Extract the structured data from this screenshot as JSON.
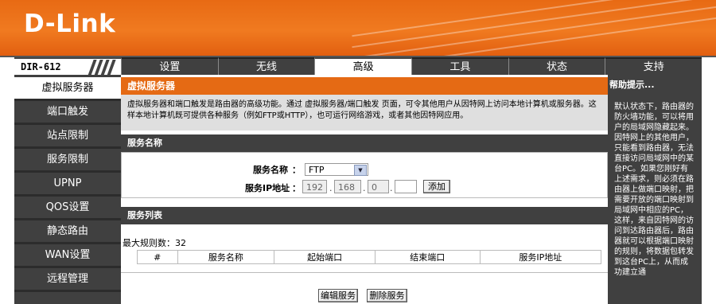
{
  "header": {
    "logo": "D-Link",
    "model": "DIR-612"
  },
  "colors": {
    "accent": "#e56a14",
    "dark": "#404040"
  },
  "tabs": [
    {
      "label": "设置",
      "active": false
    },
    {
      "label": "无线",
      "active": false
    },
    {
      "label": "高级",
      "active": true
    },
    {
      "label": "工具",
      "active": false
    },
    {
      "label": "状态",
      "active": false
    },
    {
      "label": "支持",
      "active": false
    }
  ],
  "sidebar": {
    "items": [
      {
        "label": "虚拟服务器",
        "active": true
      },
      {
        "label": "端口触发",
        "active": false
      },
      {
        "label": "站点限制",
        "active": false
      },
      {
        "label": "服务限制",
        "active": false
      },
      {
        "label": "UPNP",
        "active": false
      },
      {
        "label": "QOS设置",
        "active": false
      },
      {
        "label": "静态路由",
        "active": false
      },
      {
        "label": "WAN设置",
        "active": false
      },
      {
        "label": "远程管理",
        "active": false
      }
    ]
  },
  "help": {
    "title": "帮助提示...",
    "text": "默认状态下，路由器的防火墙功能，可以将用户的局域网隐藏起来。因特网上的其他用户，只能看到路由器，无法直接访问局域网中的某台PC。如果您刚好有上述需求，则必须在路由器上做端口映射，把需要开放的端口映射到局域网中相应的PC，这样，来自因特网的访问到达路由器后，路由器就可以根据端口映射的规则，将数据包转发到这台PC上，从而成功建立通"
  },
  "virtual_server": {
    "title": "虚拟服务器",
    "description": "虚拟服务器和端口触发是路由器的高级功能。通过 虚拟服务器/端口触发 页面，可令其他用户从因特网上访问本地计算机或服务器。这样本地计算机既可提供各种服务（例如FTP或HTTP），也可运行网络游戏，或者其他因特网应用。"
  },
  "service_name_section": {
    "title": "服务名称",
    "name_label": "服务名称",
    "name_value": "FTP",
    "ip_label": "服务IP地址",
    "colon": "：",
    "ip": [
      "192",
      "168",
      "0",
      ""
    ],
    "add_button": "添加"
  },
  "service_list": {
    "title": "服务列表",
    "max_rules": "最大规则数：32",
    "columns": [
      "#",
      "服务名称",
      "起始端口",
      "结束端口",
      "服务IP地址"
    ],
    "rows": []
  },
  "actions": {
    "edit": "编辑服务",
    "delete": "删除服务"
  }
}
